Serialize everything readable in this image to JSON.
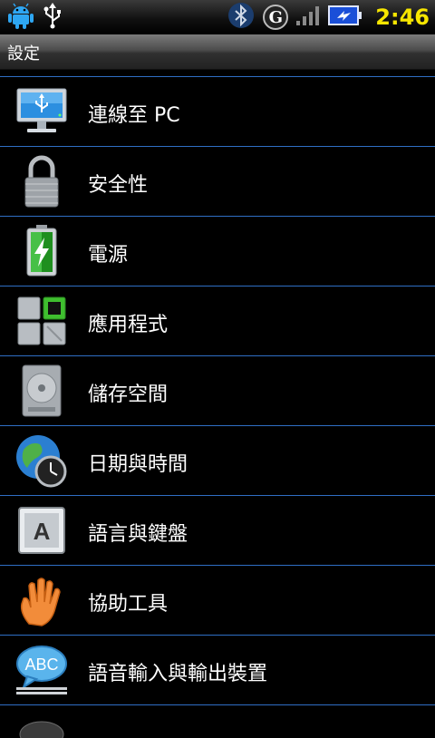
{
  "status_bar": {
    "icons_left": [
      "android-icon",
      "usb-icon"
    ],
    "icons_right": [
      "bluetooth-icon",
      "g-badge-icon",
      "signal-icon",
      "battery-charging-icon"
    ],
    "g_badge_text": "G",
    "time": "2:46",
    "time_color": "#f7e600"
  },
  "title_bar": {
    "title": "設定"
  },
  "settings": {
    "items": [
      {
        "label": "連線至 PC",
        "icon": "monitor-usb-icon"
      },
      {
        "label": "安全性",
        "icon": "padlock-icon"
      },
      {
        "label": "電源",
        "icon": "battery-charging-icon"
      },
      {
        "label": "應用程式",
        "icon": "apps-grid-icon"
      },
      {
        "label": "儲存空間",
        "icon": "hard-drive-icon"
      },
      {
        "label": "日期與時間",
        "icon": "globe-clock-icon"
      },
      {
        "label": "語言與鍵盤",
        "icon": "keyboard-key-a-icon"
      },
      {
        "label": "協助工具",
        "icon": "hand-icon"
      },
      {
        "label": "語音輸入與輸出裝置",
        "icon": "speech-bubble-abc-icon"
      }
    ],
    "key_a_text": "A",
    "speech_bubble_text": "ABC"
  },
  "colors": {
    "divider": "#2f6ec4",
    "background": "#000000"
  }
}
